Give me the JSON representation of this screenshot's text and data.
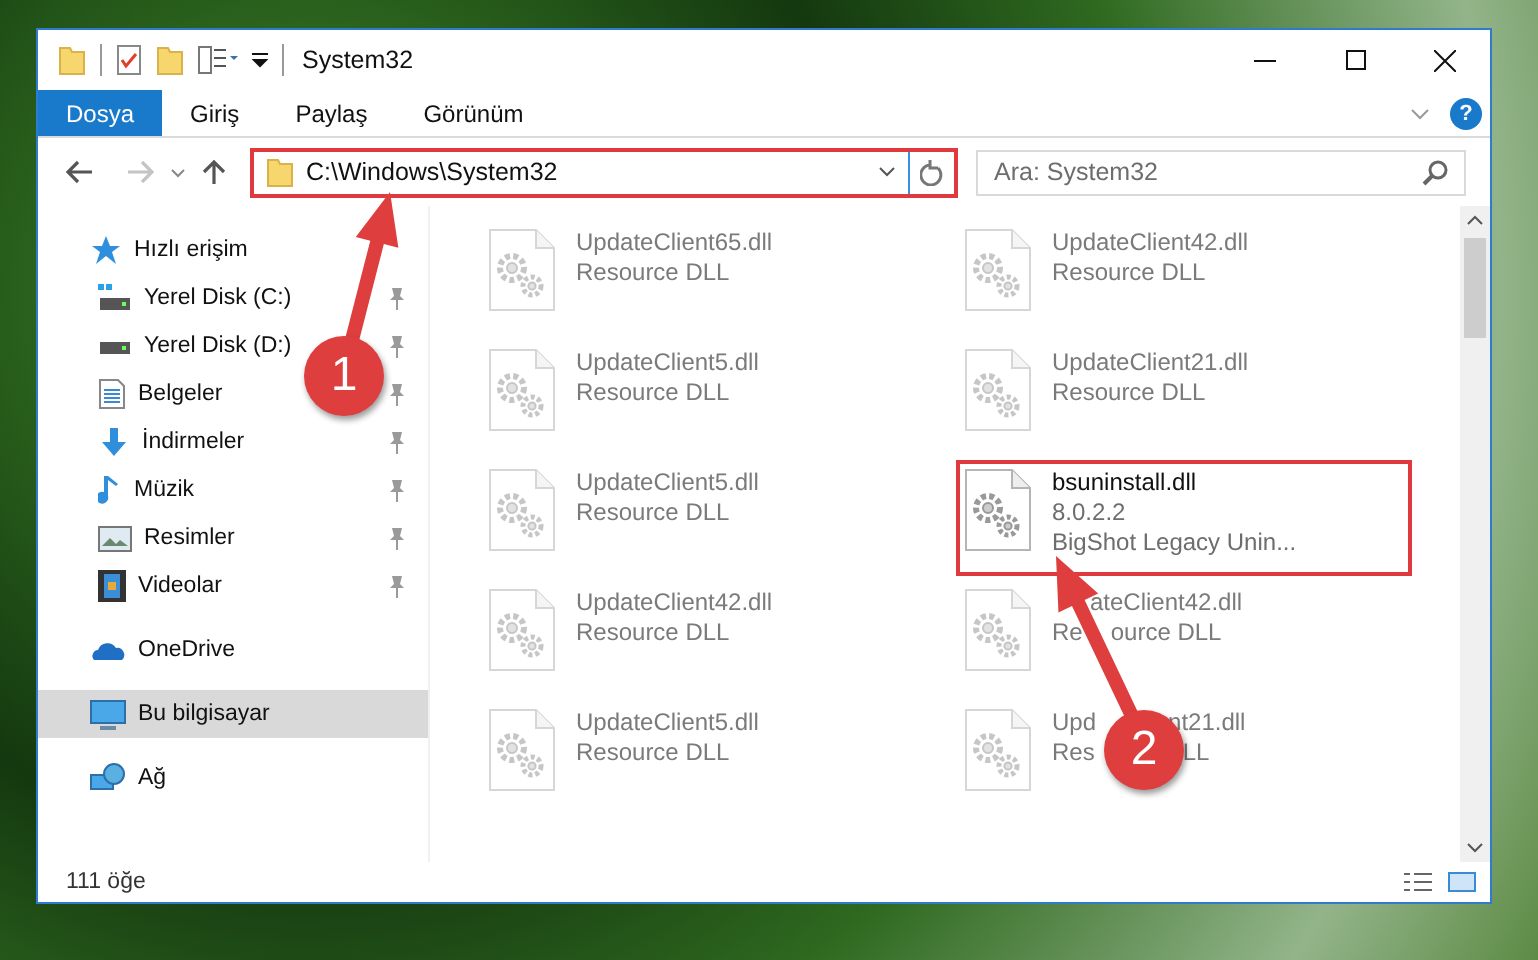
{
  "window": {
    "title": "System32"
  },
  "ribbon_tabs": [
    {
      "label": "Dosya",
      "kind": "file",
      "selected": false
    },
    {
      "label": "Giriş",
      "kind": "tab",
      "selected": false
    },
    {
      "label": "Paylaş",
      "kind": "tab",
      "selected": false
    },
    {
      "label": "Görünüm",
      "kind": "tab",
      "selected": false
    }
  ],
  "help_button": "?",
  "address_bar": {
    "value": "C:\\Windows\\System32",
    "highlighted": true
  },
  "search": {
    "placeholder": "Ara: System32"
  },
  "sidebar": {
    "items": [
      {
        "label": "Hızlı erişim",
        "kind": "star",
        "selected": false,
        "children": [
          {
            "label": "Yerel Disk (C:)",
            "kind": "windrive",
            "pinned": true,
            "selected": false
          },
          {
            "label": "Yerel Disk (D:)",
            "kind": "drive",
            "pinned": true,
            "selected": false
          },
          {
            "label": "Belgeler",
            "kind": "docs",
            "pinned": true,
            "selected": false
          },
          {
            "label": "İndirmeler",
            "kind": "download",
            "pinned": true,
            "selected": false
          },
          {
            "label": "Müzik",
            "kind": "music",
            "pinned": true,
            "selected": false
          },
          {
            "label": "Resimler",
            "kind": "pictures",
            "pinned": true,
            "selected": false
          },
          {
            "label": "Videolar",
            "kind": "videos",
            "pinned": true,
            "selected": false
          }
        ]
      },
      {
        "label": "OneDrive",
        "kind": "cloud",
        "selected": false
      },
      {
        "label": "Bu bilgisayar",
        "kind": "pc",
        "selected": true
      },
      {
        "label": "Ağ",
        "kind": "network",
        "selected": false
      }
    ]
  },
  "files": [
    {
      "name": [
        "UpdateClient65.dll"
      ],
      "lines": [
        [
          "Resource DLL"
        ]
      ],
      "blurred": true,
      "highlighted": false
    },
    {
      "name": [
        "UpdateClient42.dll"
      ],
      "lines": [
        [
          "Resource DLL"
        ]
      ],
      "blurred": true,
      "highlighted": false
    },
    {
      "name": [
        "UpdateClient5.dll"
      ],
      "lines": [
        [
          "Resource DLL"
        ]
      ],
      "blurred": true,
      "highlighted": false
    },
    {
      "name": [
        "UpdateClient21.dll"
      ],
      "lines": [
        [
          "Resource DLL"
        ]
      ],
      "blurred": true,
      "highlighted": false
    },
    {
      "name": [
        "UpdateClient5.dll"
      ],
      "lines": [
        [
          "Resource DLL"
        ]
      ],
      "blurred": true,
      "highlighted": false
    },
    {
      "name": [
        "bsuninstall.dll"
      ],
      "lines": [
        [
          "8.0.2.2"
        ],
        [
          "BigShot Legacy Unin..."
        ]
      ],
      "blurred": false,
      "highlighted": true
    },
    {
      "name": [
        "UpdateClient42.dll"
      ],
      "lines": [
        [
          "Resource DLL"
        ]
      ],
      "blurred": true,
      "highlighted": false
    },
    {
      "name": [
        "ateClient42.dll"
      ],
      "lines": [
        [
          "Re",
          "ource DLL"
        ]
      ],
      "blurred": true,
      "highlighted": false
    },
    {
      "name": [
        "UpdateClient5.dll"
      ],
      "lines": [
        [
          "Resource DLL"
        ]
      ],
      "blurred": true,
      "highlighted": false
    },
    {
      "name": [
        "Upd",
        "nt21.dll"
      ],
      "lines": [
        [
          "Res",
          "LL"
        ]
      ],
      "blurred": true,
      "highlighted": false
    }
  ],
  "status_bar": {
    "count": "111 öğe"
  },
  "callouts": [
    {
      "label": "1"
    },
    {
      "label": "2"
    }
  ]
}
